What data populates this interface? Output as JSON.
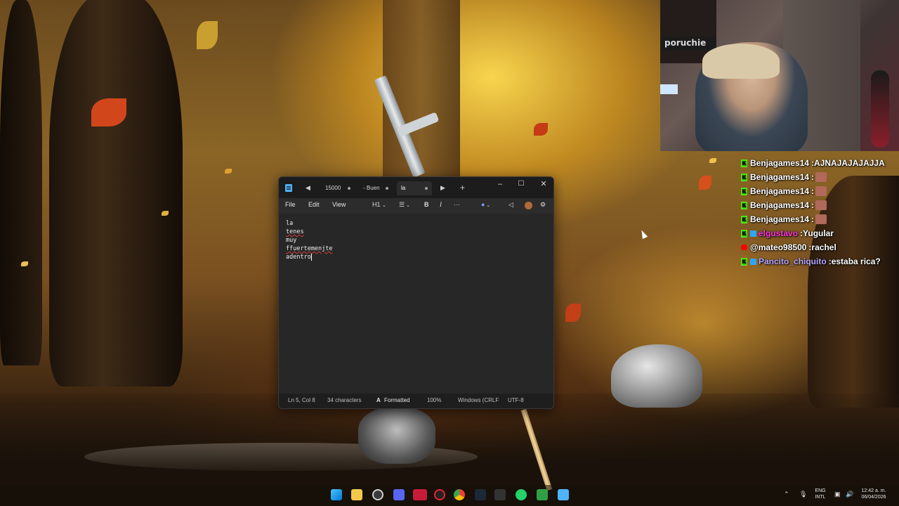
{
  "notepad": {
    "tabs": [
      {
        "label": "15000",
        "modified": true
      },
      {
        "label": "- Buen",
        "modified": true
      },
      {
        "label": "la",
        "modified": true,
        "active": true
      }
    ],
    "menu": {
      "file": "File",
      "edit": "Edit",
      "view": "View"
    },
    "toolbar": {
      "heading": "H1"
    },
    "lines": [
      "la",
      "tenes",
      "muy",
      "ffuertemenjte",
      "adentro"
    ],
    "misspelled_lines": [
      1,
      3
    ],
    "status": {
      "position": "Ln 5, Col 8",
      "characters": "34 characters",
      "format": "Formatted",
      "zoom": "100%",
      "line_ending": "Windows (CRLF",
      "encoding": "UTF-8"
    }
  },
  "webcam": {
    "sign_text": "poruchie"
  },
  "chat": [
    {
      "platform": "kick",
      "user": "Benjagames14",
      "message": "AJNAJAJAJAJJA",
      "emote": false
    },
    {
      "platform": "kick",
      "user": "Benjagames14",
      "message": "",
      "emote": true
    },
    {
      "platform": "kick",
      "user": "Benjagames14",
      "message": "",
      "emote": true
    },
    {
      "platform": "kick",
      "user": "Benjagames14",
      "message": "",
      "emote": true
    },
    {
      "platform": "kick",
      "user": "Benjagames14",
      "message": "",
      "emote": true
    },
    {
      "platform": "kick-mod",
      "user": "elgustavo",
      "message": "Yugular",
      "emote": false
    },
    {
      "platform": "youtube",
      "user": "@mateo98500",
      "message": "rachel",
      "emote": false
    },
    {
      "platform": "kick-mod",
      "user": "Pancito_chiquito",
      "message": "estaba rica?",
      "emote": false
    }
  ],
  "taskbar": {
    "lang_top": "ENG",
    "lang_bottom": "INTL",
    "time": "12:42 a. m.",
    "date": "06/04/2026"
  }
}
